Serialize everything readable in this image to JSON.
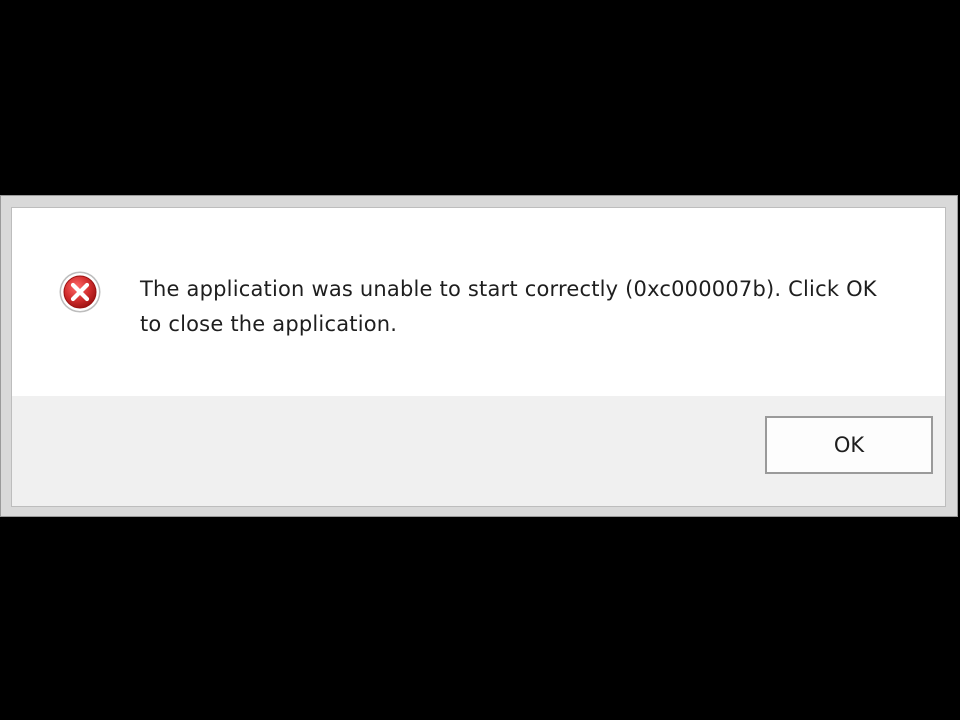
{
  "dialog": {
    "icon": "error-icon",
    "message_line1": "The application was unable to start correctly (0xc000007b). Click OK",
    "message_line2": "to close the application.",
    "ok_label": "OK"
  },
  "colors": {
    "background": "#000000",
    "dialog_content": "#ffffff",
    "dialog_footer": "#f0f0f0",
    "error_red": "#d32f2f"
  }
}
